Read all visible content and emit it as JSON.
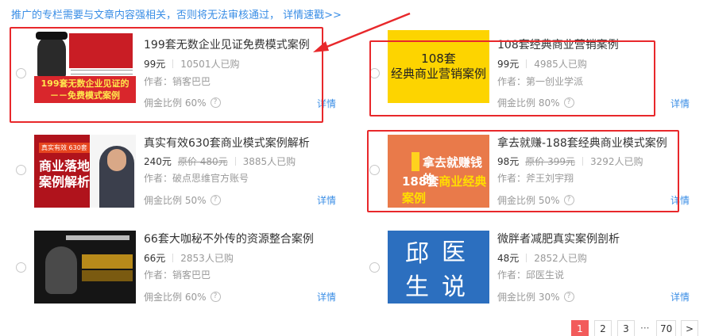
{
  "notice": {
    "text": "推广的专栏需要与文章内容强相关，否则将无法审核通过， 详情速戳>>"
  },
  "labels": {
    "commission_prefix": "佣金比例",
    "detail": "详情",
    "author_prefix": "作者："
  },
  "cards": [
    {
      "title": "199套无数企业见证免费模式案例",
      "price": "99元",
      "original_price": "",
      "buyers": "10501人已购",
      "author": "作者：销客巴巴",
      "commission": "佣金比例 60%",
      "detail": "详情",
      "thumb_text": [
        "199套无数企业见证的",
        "－－免费模式案例"
      ]
    },
    {
      "title": "108套经典商业营销案例",
      "price": "99元",
      "original_price": "",
      "buyers": "4985人已购",
      "author": "作者：第一创业学派",
      "commission": "佣金比例 80%",
      "detail": "详情",
      "thumb_text": [
        "108套",
        "经典商业营销案例"
      ]
    },
    {
      "title": "真实有效630套商业模式案例解析",
      "price": "240元",
      "original_price": "原价 480元",
      "buyers": "3885人已购",
      "author": "作者：破点思维官方账号",
      "commission": "佣金比例 50%",
      "detail": "详情",
      "thumb_text": [
        "真实有效 630套",
        "商业落地",
        "案例解析"
      ]
    },
    {
      "title": "拿去就赚-188套经典商业模式案例",
      "price": "98元",
      "original_price": "原价 399元",
      "buyers": "3292人已购",
      "author": "作者：斧王刘宇翔",
      "commission": "佣金比例 50%",
      "detail": "详情",
      "thumb_text": [
        "拿去就赚钱的",
        "188套",
        "商业经典案例"
      ]
    },
    {
      "title": "66套大咖秘不外传的资源整合案例",
      "price": "66元",
      "original_price": "",
      "buyers": "2853人已购",
      "author": "作者：销客巴巴",
      "commission": "佣金比例 60%",
      "detail": "详情",
      "thumb_text": []
    },
    {
      "title": "微胖者减肥真实案例剖析",
      "price": "48元",
      "original_price": "",
      "buyers": "2852人已购",
      "author": "作者：邱医生说",
      "commission": "佣金比例 30%",
      "detail": "详情",
      "thumb_text": [
        "邱",
        "医",
        "生",
        "说"
      ]
    }
  ],
  "pagination": {
    "pages": [
      "1",
      "2",
      "3"
    ],
    "ellipsis": "···",
    "last": "70",
    "next": ">",
    "current": "1"
  },
  "colors": {
    "link": "#3a8ee6",
    "highlight": "#e8282b",
    "active_page": "#f25b5b"
  },
  "icons": {
    "help": "question-circle-icon",
    "arrow": "red-arrow-annotation"
  }
}
